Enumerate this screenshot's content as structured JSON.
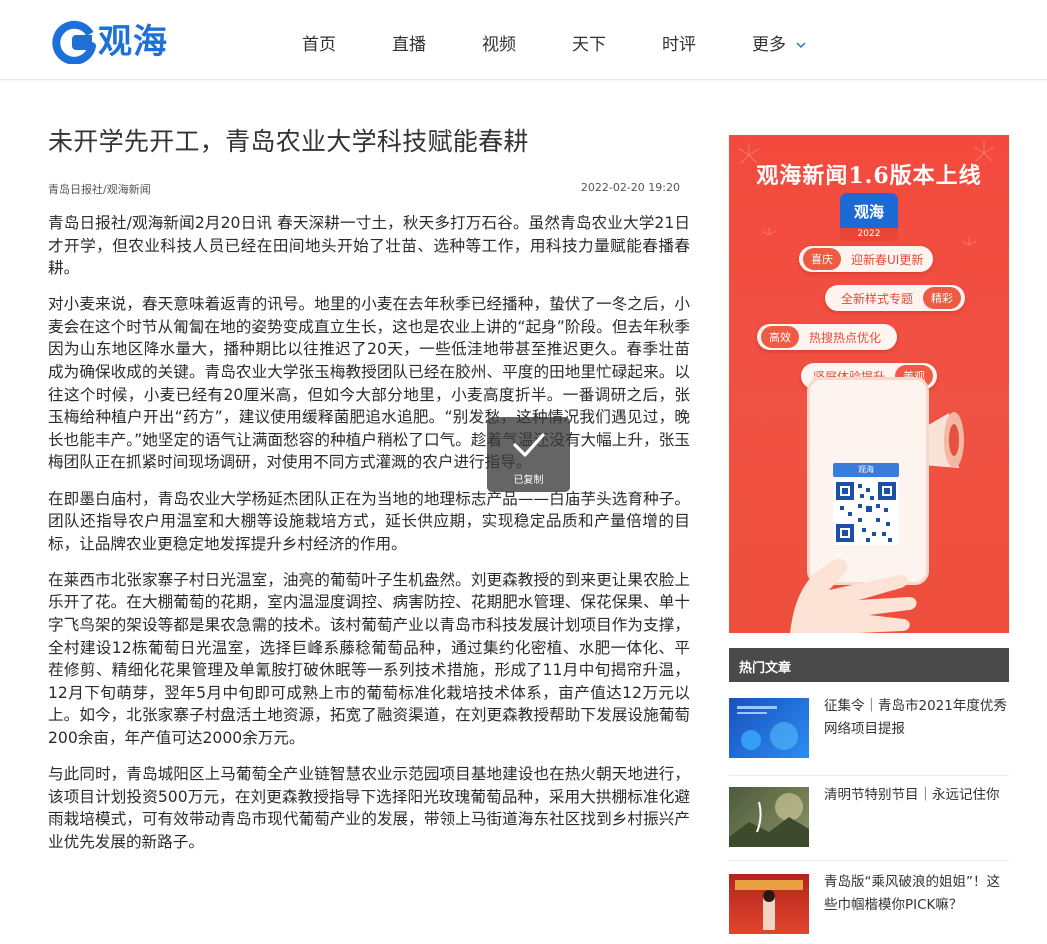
{
  "site": {
    "logo_text": "观海"
  },
  "nav": {
    "items": [
      "首页",
      "直播",
      "视频",
      "天下",
      "时评"
    ],
    "more_label": "更多"
  },
  "article": {
    "title": "未开学先开工，青岛农业大学科技赋能春耕",
    "source": "青岛日报社/观海新闻",
    "time": "2022-02-20 19:20",
    "paragraphs": [
      "青岛日报社/观海新闻2月20日讯 春天深耕一寸土，秋天多打万石谷。虽然青岛农业大学21日才开学，但农业科技人员已经在田间地头开始了壮苗、选种等工作，用科技力量赋能春播春耕。",
      "对小麦来说，春天意味着返青的讯号。地里的小麦在去年秋季已经播种，蛰伏了一冬之后，小麦会在这个时节从匍匐在地的姿势变成直立生长，这也是农业上讲的“起身”阶段。但去年秋季因为山东地区降水量大，播种期比以往推迟了20天，一些低洼地带甚至推迟更久。春季壮苗成为确保收成的关键。青岛农业大学张玉梅教授团队已经在胶州、平度的田地里忙碌起来。以往这个时候，小麦已经有20厘米高，但如今大部分地里，小麦高度折半。一番调研之后，张玉梅给种植户开出“药方”，建议使用缓释菌肥追水追肥。“别发愁，这种情况我们遇见过，晚长也能丰产。”她坚定的语气让满面愁容的种植户稍松了口气。趁着气温还没有大幅上升，张玉梅团队正在抓紧时间现场调研，对使用不同方式灌溉的农户进行指导。",
      "在即墨白庙村，青岛农业大学杨延杰团队正在为当地的地理标志产品——白庙芋头选育种子。团队还指导农户用温室和大棚等设施栽培方式，延长供应期，实现稳定品质和产量倍增的目标，让品牌农业更稳定地发挥提升乡村经济的作用。",
      "在莱西市北张家寨子村日光温室，油亮的葡萄叶子生机盎然。刘更森教授的到来更让果农脸上乐开了花。在大棚葡萄的花期，室内温湿度调控、病害防控、花期肥水管理、保花保果、单十字飞鸟架的架设等都是果农急需的技术。该村葡萄产业以青岛市科技发展计划项目作为支撑，全村建设12栋葡萄日光温室，选择巨峰系藤稔葡萄品种，通过集约化密植、水肥一体化、平茬修剪、精细化花果管理及单氰胺打破休眠等一系列技术措施，形成了11月中旬揭帘升温，12月下旬萌芽，翌年5月中旬即可成熟上市的葡萄标准化栽培技术体系，亩产值达12万元以上。如今，北张家寨子村盘活土地资源，拓宽了融资渠道，在刘更森教授帮助下发展设施葡萄200余亩，年产值可达2000余万元。",
      "与此同时，青岛城阳区上马葡萄全产业链智慧农业示范园项目基地建设也在热火朝天地进行，该项目计划投资500万元，在刘更森教授指导下选择阳光玫瑰葡萄品种，采用大拱棚标准化避雨栽培模式，可有效带动青岛市现代葡萄产业的发展，带领上马街道海东社区找到乡村振兴产业优先发展的新路子。"
    ]
  },
  "toast": {
    "label": "已复制"
  },
  "banner": {
    "title": "观海新闻1.6版本上线",
    "app_name": "观海",
    "app_year": "2022",
    "pills": [
      {
        "tag": "喜庆",
        "text": "迎新春UI更新"
      },
      {
        "tag": "精彩",
        "text": "全新样式专题"
      },
      {
        "tag": "高效",
        "text": "热搜热点优化"
      },
      {
        "tag": "美观",
        "text": "竖屏体验提升"
      }
    ],
    "qr_label": "观海"
  },
  "hot": {
    "header": "热门文章",
    "items": [
      {
        "title": "征集令｜青岛市2021年度优秀网络项目提报"
      },
      {
        "title": "清明节特别节目｜永远记住你"
      },
      {
        "title": "青岛版“乘风破浪的姐姐”！这些巾帼楷模你PICK嘛？"
      }
    ]
  },
  "colors": {
    "brand_blue": "#1f6fd8",
    "banner_red": "#f34a3e",
    "hot_header": "#4a4a4a"
  }
}
